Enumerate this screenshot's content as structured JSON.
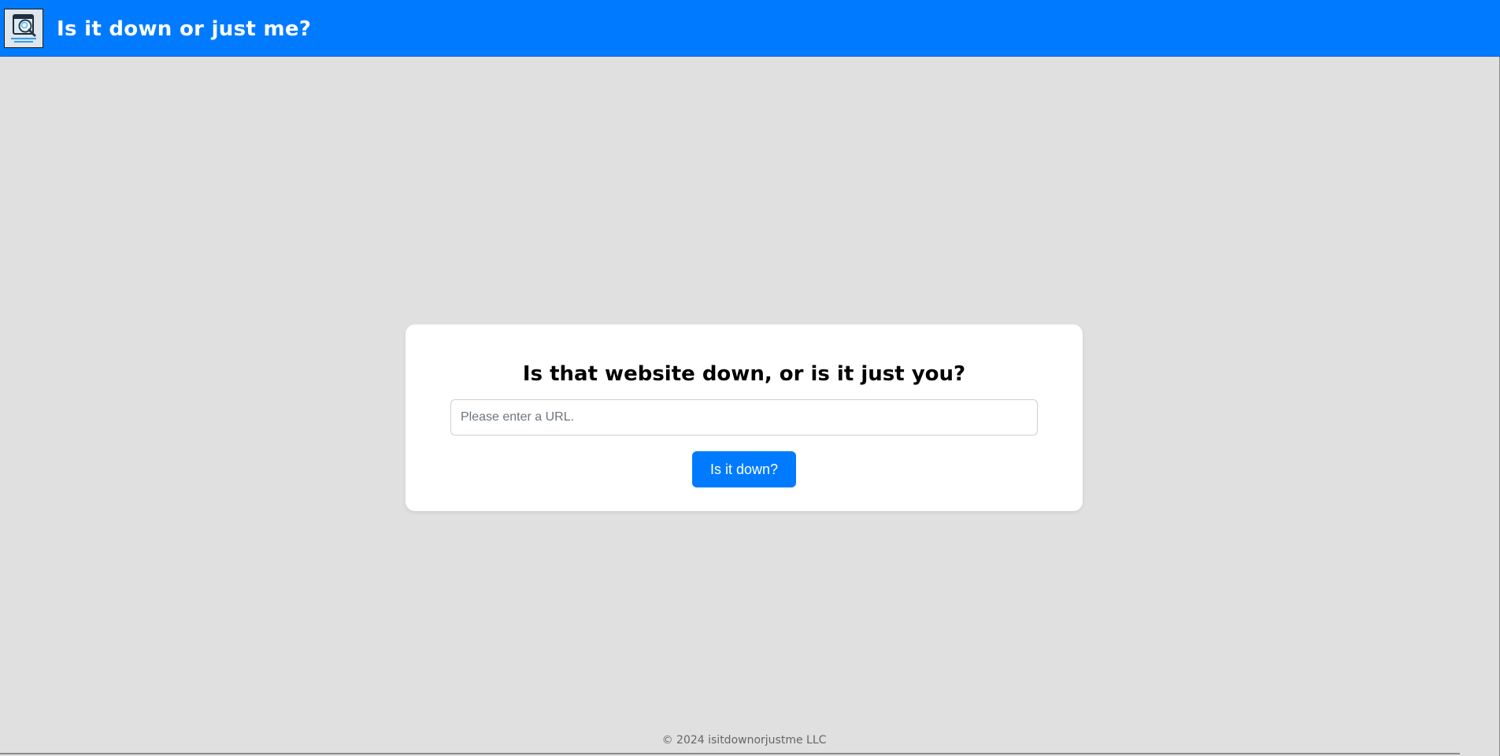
{
  "app": {
    "title": "Is it down or just me?",
    "logo_icon": "browser-magnifier-icon"
  },
  "main": {
    "heading": "Is that website down, or is it just you?",
    "url_input": {
      "value": "",
      "placeholder": "Please enter a URL."
    },
    "submit_label": "Is it down?"
  },
  "footer": {
    "copyright": "© 2024 isitdownorjustme LLC"
  },
  "colors": {
    "accent": "#007bff",
    "background": "#e0e0e0",
    "card": "#ffffff",
    "footer_text": "#666666"
  }
}
